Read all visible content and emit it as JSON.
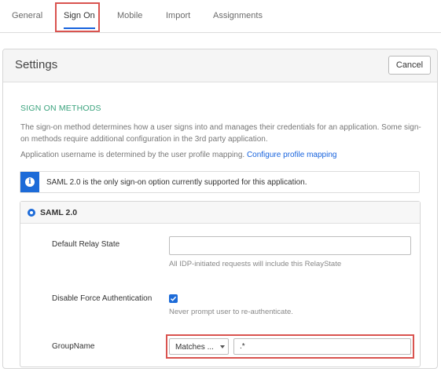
{
  "tabs": [
    {
      "label": "General"
    },
    {
      "label": "Sign On"
    },
    {
      "label": "Mobile"
    },
    {
      "label": "Import"
    },
    {
      "label": "Assignments"
    }
  ],
  "active_tab": "Sign On",
  "settings": {
    "title": "Settings",
    "cancel_label": "Cancel"
  },
  "sign_on": {
    "section_title": "SIGN ON METHODS",
    "description": "The sign-on method determines how a user signs into and manages their credentials for an application. Some sign-on methods require additional configuration in the 3rd party application.",
    "mapping_text": "Application username is determined by the user profile mapping.",
    "mapping_link": "Configure profile mapping",
    "info_icon": "i",
    "info_text": "SAML 2.0 is the only sign-on option currently supported for this application."
  },
  "saml": {
    "label": "SAML 2.0",
    "relay_state_label": "Default Relay State",
    "relay_state_value": "",
    "relay_state_hint": "All IDP-initiated requests will include this RelayState",
    "force_auth_label": "Disable Force Authentication",
    "force_auth_checked": true,
    "force_auth_hint": "Never prompt user to re-authenticate.",
    "group_name_label": "GroupName",
    "group_match_selected": "Matches ...",
    "group_value": ".*"
  },
  "colors": {
    "accent": "#1d6bd8",
    "section_title": "#3aa37d",
    "highlight": "#d9534f"
  }
}
